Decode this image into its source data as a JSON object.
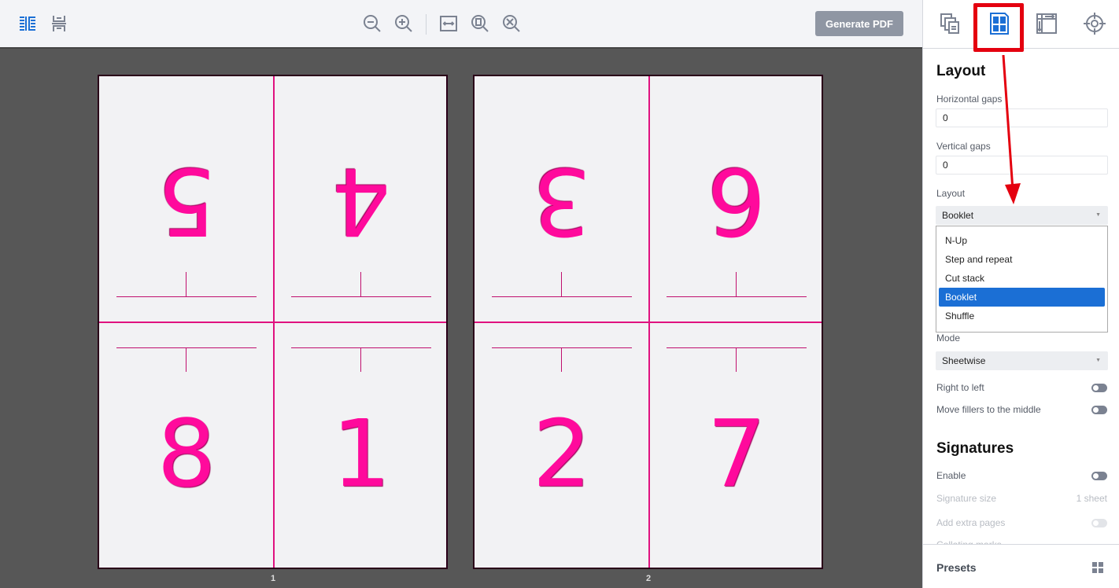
{
  "toolbar": {
    "generate_label": "Generate PDF",
    "icons": [
      "side-by-side-view-icon",
      "stacked-view-icon",
      "zoom-out-icon",
      "zoom-in-icon",
      "fit-width-icon",
      "fit-page-icon",
      "zoom-reset-icon"
    ]
  },
  "sheets": [
    {
      "label": "1",
      "pages": {
        "top_left": "5",
        "top_right": "4",
        "bottom_left": "8",
        "bottom_right": "1"
      }
    },
    {
      "label": "2",
      "pages": {
        "top_left": "3",
        "top_right": "6",
        "bottom_left": "2",
        "bottom_right": "7"
      }
    }
  ],
  "panel": {
    "tabs": [
      "pages-icon",
      "layout-icon",
      "sheet-size-icon",
      "marks-icon"
    ],
    "active_tab": "layout-icon",
    "layout_title": "Layout",
    "hgaps_label": "Horizontal gaps",
    "hgaps_value": "0",
    "vgaps_label": "Vertical gaps",
    "vgaps_value": "0",
    "layout_label": "Layout",
    "layout_value": "Booklet",
    "layout_options": [
      "N-Up",
      "Step and repeat",
      "Cut stack",
      "Booklet",
      "Shuffle"
    ],
    "mode_label": "Mode",
    "mode_value": "Sheetwise",
    "rtl_label": "Right to left",
    "fillers_label": "Move fillers to the middle",
    "signatures_title": "Signatures",
    "enable_label": "Enable",
    "sigsize_label": "Signature size",
    "sigsize_value": "1 sheet",
    "extra_label": "Add extra pages",
    "collating_label": "Collating marks",
    "presets_label": "Presets"
  },
  "colors": {
    "accent": "#1b6fd5",
    "page_number": "#ff0a9c",
    "highlight": "#e4000f"
  }
}
